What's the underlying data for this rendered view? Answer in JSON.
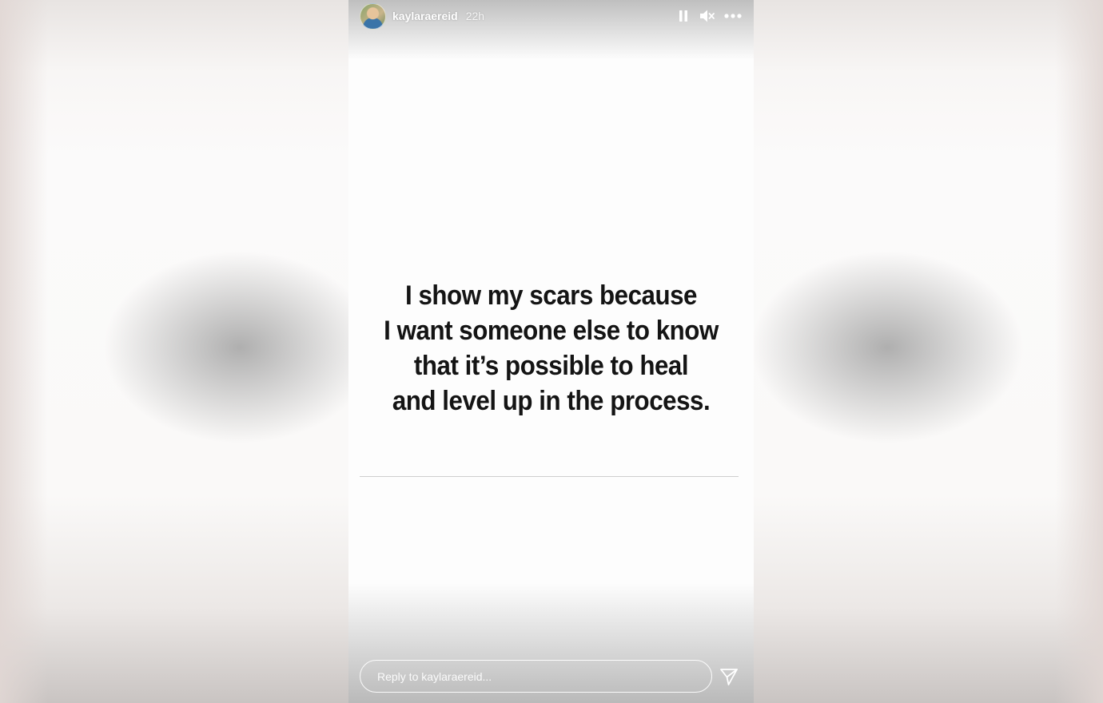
{
  "story": {
    "username": "kaylaraereid",
    "timestamp": "22h",
    "quote_lines": [
      "I show my scars because",
      "I want someone else to know",
      "that it’s possible to heal",
      "and level up in the process."
    ]
  },
  "controls": {
    "pause_icon": "pause-icon",
    "mute_icon": "muted-speaker-icon",
    "more_icon": "more-options-icon"
  },
  "reply": {
    "placeholder": "Reply to kaylaraereid...",
    "send_icon": "send-paper-plane-icon"
  },
  "colors": {
    "story_background": "#fdfdfd",
    "quote_text": "#141414",
    "header_text": "#ffffff"
  }
}
